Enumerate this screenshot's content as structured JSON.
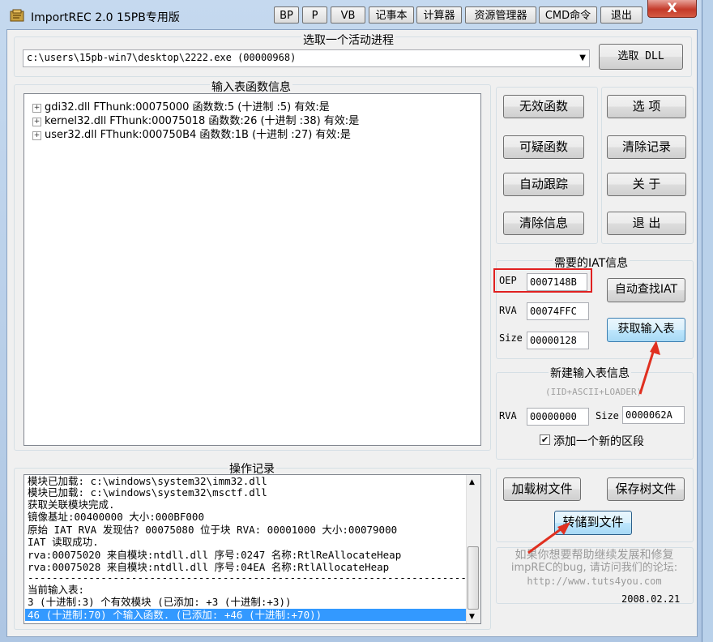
{
  "window": {
    "title": "ImportREC 2.0 15PB专用版",
    "close_label": "X"
  },
  "titlebar_buttons": [
    "BP",
    "P",
    "VB",
    "记事本",
    "计算器",
    "资源管理器",
    "CMD命令",
    "退出"
  ],
  "process_group": {
    "label": "选取一个活动进程",
    "selected_process": "c:\\users\\15pb-win7\\desktop\\2222.exe (00000968)",
    "pick_dll_label": "选取 DLL"
  },
  "import_group": {
    "label": "输入表函数信息",
    "items": [
      "gdi32.dll FThunk:00075000 函数数:5 (十进制 :5) 有效:是",
      "kernel32.dll FThunk:00075018 函数数:26 (十进制 :38) 有效:是",
      "user32.dll FThunk:000750B4 函数数:1B (十进制 :27) 有效:是"
    ]
  },
  "side_buttons": {
    "invalid_funcs": "无效函数",
    "options": "选  项",
    "suspect_funcs": "可疑函数",
    "clear_log": "清除记录",
    "auto_trace": "自动跟踪",
    "about": "关  于",
    "clear_info": "清除信息",
    "exit": "退  出"
  },
  "iat_group": {
    "label": "需要的IAT信息",
    "oep_label": "OEP",
    "oep_value": "0007148B",
    "rva_label": "RVA",
    "rva_value": "00074FFC",
    "size_label": "Size",
    "size_value": "00000128",
    "auto_find_label": "自动查找IAT",
    "get_imports_label": "获取输入表"
  },
  "new_import_group": {
    "label": "新建输入表信息",
    "hint": "(IID+ASCII+LOADER)",
    "rva_label": "RVA",
    "rva_value": "00000000",
    "size_label": "Size",
    "size_value": "0000062A",
    "add_section_label": "添加一个新的区段",
    "add_section_checked": true
  },
  "log_group": {
    "label": "操作记录",
    "lines": [
      "模块已加载: c:\\windows\\system32\\imm32.dll",
      "模块已加载: c:\\windows\\system32\\msctf.dll",
      "获取关联模块完成.",
      "镜像基址:00400000 大小:000BF000",
      "原始 IAT RVA 发现估? 00075080 位于块 RVA: 00001000 大小:00079000",
      "IAT 读取成功.",
      "rva:00075020 来自模块:ntdll.dll 序号:0247 名称:RtlReAllocateHeap",
      "rva:00075028 来自模块:ntdll.dll 序号:04EA 名称:RtlAllocateHeap",
      "----------------------------------------------------------------------------",
      "当前输入表:",
      "3 (十进制:3) 个有效模块 (已添加: +3 (十进制:+3))",
      "46 (十进制:70) 个输入函数. (已添加: +46 (十进制:+70))"
    ]
  },
  "tree_buttons": {
    "load_tree": "加载树文件",
    "save_tree": "保存树文件",
    "dump_to_file": "转储到文件"
  },
  "footer": {
    "note_line1": "如果你想要帮助继续发展和修复",
    "note_line2": "impREC的bug, 请访问我们的论坛:",
    "note_line3": "http://www.tuts4you.com",
    "date": "2008.02.21"
  },
  "colors": {
    "highlight": "#3399ff",
    "annotation_red": "#e03020"
  }
}
